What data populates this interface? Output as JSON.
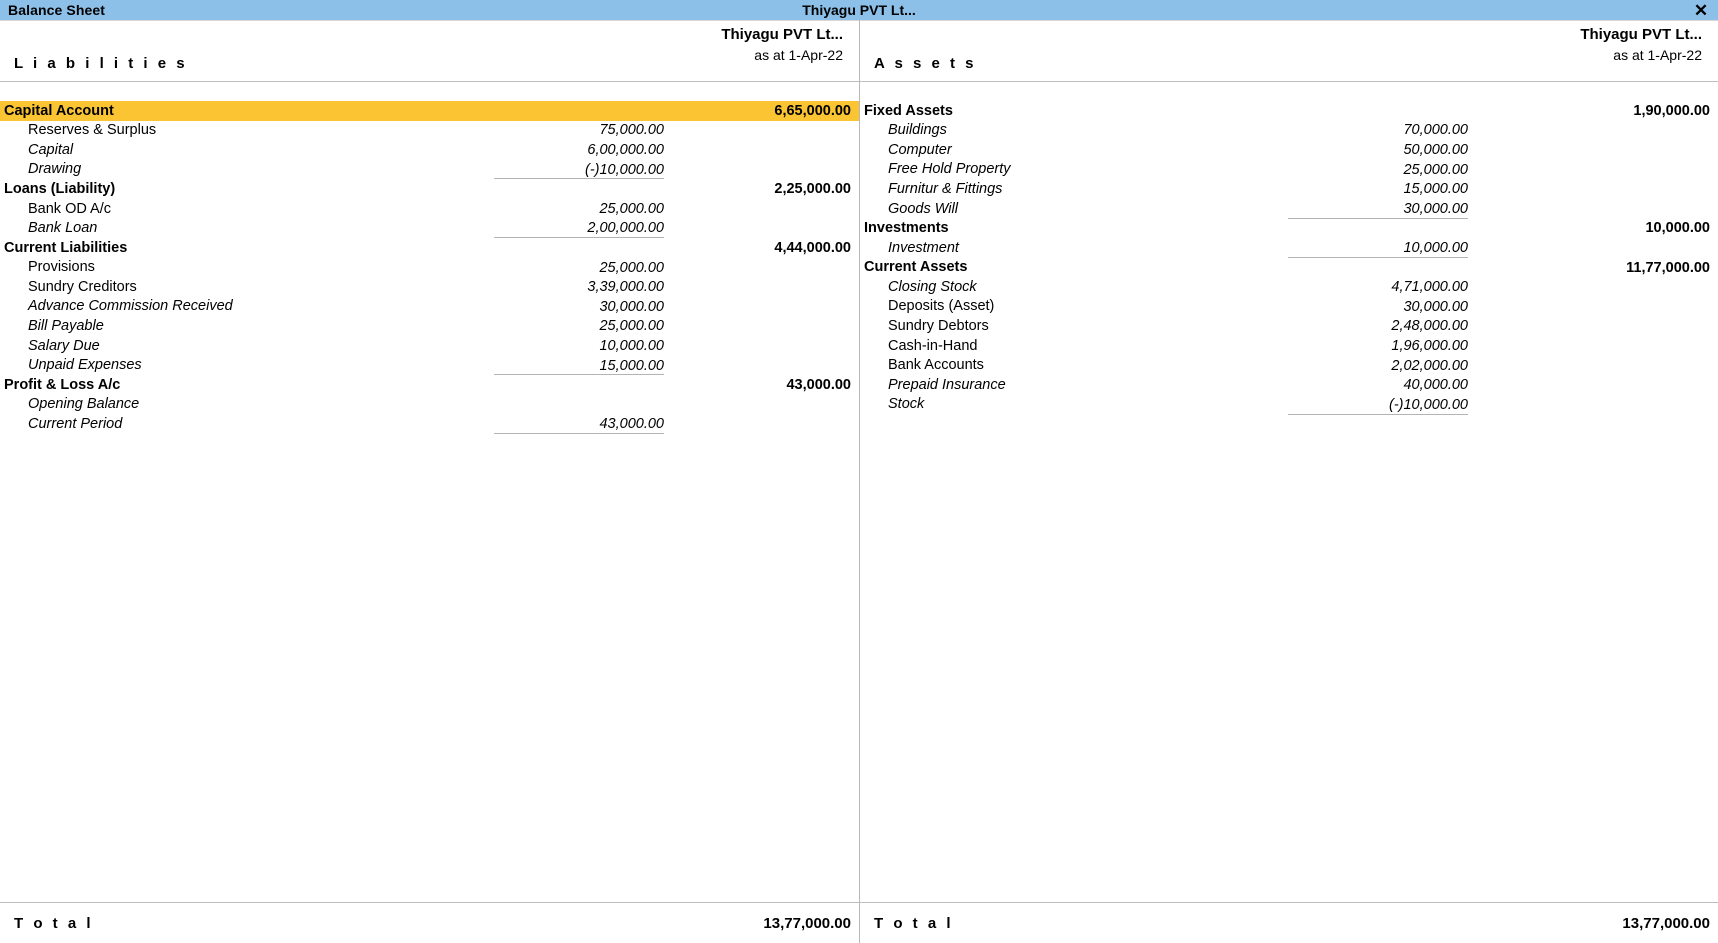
{
  "window": {
    "title": "Balance Sheet",
    "company": "Thiyagu PVT Lt...",
    "close_icon": "close-icon",
    "close_glyph": "✕",
    "titlebar_color": "#8CC0E8",
    "highlight_color": "#FBC433"
  },
  "left": {
    "side_title": "L i a b i l i t i e s",
    "company": "Thiyagu PVT Lt...",
    "as_at": "as at 1-Apr-22",
    "groups": [
      {
        "name": "Capital Account",
        "total": "6,65,000.00",
        "highlighted": true,
        "items": [
          {
            "label": "Reserves & Surplus",
            "value": "75,000.00",
            "italic": false
          },
          {
            "label": "Capital",
            "value": "6,00,000.00",
            "italic": true
          },
          {
            "label": "Drawing",
            "value": "(-)10,000.00",
            "italic": true
          }
        ]
      },
      {
        "name": "Loans (Liability)",
        "total": "2,25,000.00",
        "highlighted": false,
        "items": [
          {
            "label": "Bank OD A/c",
            "value": "25,000.00",
            "italic": false
          },
          {
            "label": "Bank Loan",
            "value": "2,00,000.00",
            "italic": true
          }
        ]
      },
      {
        "name": "Current Liabilities",
        "total": "4,44,000.00",
        "highlighted": false,
        "items": [
          {
            "label": "Provisions",
            "value": "25,000.00",
            "italic": false
          },
          {
            "label": "Sundry Creditors",
            "value": "3,39,000.00",
            "italic": false
          },
          {
            "label": "Advance Commission Received",
            "value": "30,000.00",
            "italic": true
          },
          {
            "label": "Bill Payable",
            "value": "25,000.00",
            "italic": true
          },
          {
            "label": "Salary Due",
            "value": "10,000.00",
            "italic": true
          },
          {
            "label": "Unpaid Expenses",
            "value": "15,000.00",
            "italic": true
          }
        ]
      },
      {
        "name": "Profit & Loss A/c",
        "total": "43,000.00",
        "highlighted": false,
        "items": [
          {
            "label": "Opening Balance",
            "value": "",
            "italic": true
          },
          {
            "label": "Current Period",
            "value": "43,000.00",
            "italic": true
          }
        ]
      }
    ],
    "total_label": "T o t a l",
    "total_value": "13,77,000.00"
  },
  "right": {
    "side_title": "A s s e t s",
    "company": "Thiyagu PVT Lt...",
    "as_at": "as at 1-Apr-22",
    "groups": [
      {
        "name": "Fixed Assets",
        "total": "1,90,000.00",
        "highlighted": false,
        "items": [
          {
            "label": "Buildings",
            "value": "70,000.00",
            "italic": true
          },
          {
            "label": "Computer",
            "value": "50,000.00",
            "italic": true
          },
          {
            "label": "Free Hold Property",
            "value": "25,000.00",
            "italic": true
          },
          {
            "label": "Furnitur & Fittings",
            "value": "15,000.00",
            "italic": true
          },
          {
            "label": "Goods Will",
            "value": "30,000.00",
            "italic": true
          }
        ]
      },
      {
        "name": "Investments",
        "total": "10,000.00",
        "highlighted": false,
        "items": [
          {
            "label": "Investment",
            "value": "10,000.00",
            "italic": true
          }
        ]
      },
      {
        "name": "Current Assets",
        "total": "11,77,000.00",
        "highlighted": false,
        "items": [
          {
            "label": "Closing Stock",
            "value": "4,71,000.00",
            "italic": true
          },
          {
            "label": "Deposits (Asset)",
            "value": "30,000.00",
            "italic": false
          },
          {
            "label": "Sundry Debtors",
            "value": "2,48,000.00",
            "italic": false
          },
          {
            "label": "Cash-in-Hand",
            "value": "1,96,000.00",
            "italic": false
          },
          {
            "label": "Bank Accounts",
            "value": "2,02,000.00",
            "italic": false
          },
          {
            "label": "Prepaid Insurance",
            "value": "40,000.00",
            "italic": true
          },
          {
            "label": "Stock",
            "value": "(-)10,000.00",
            "italic": true
          }
        ]
      }
    ],
    "total_label": "T o t a l",
    "total_value": "13,77,000.00"
  }
}
